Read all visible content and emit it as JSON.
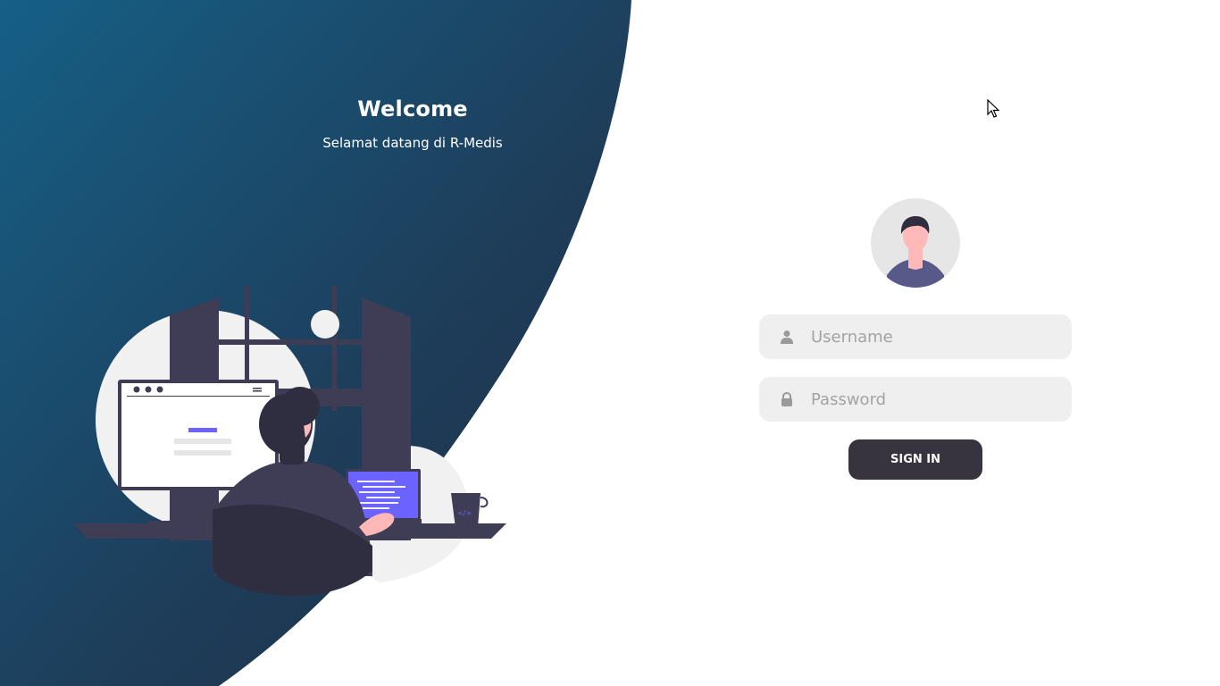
{
  "welcome": {
    "title": "Welcome",
    "subtitle": "Selamat datang di R-Medis"
  },
  "login": {
    "username_placeholder": "Username",
    "password_placeholder": "Password",
    "submit_label": "SIGN IN"
  },
  "icons": {
    "username": "user-icon",
    "password": "lock-icon"
  },
  "colors": {
    "gradient_start": "#165f86",
    "gradient_end": "#1b2e45",
    "button": "#38343d",
    "field_bg": "#efefef",
    "accent": "#6c63ff"
  }
}
